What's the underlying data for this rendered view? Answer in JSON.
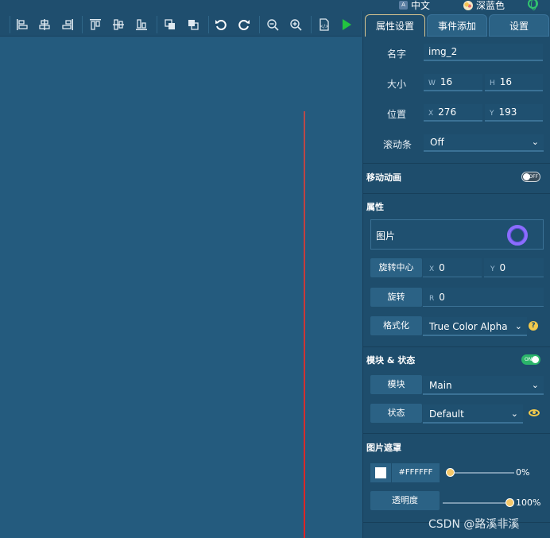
{
  "topbar": {
    "language": "中文",
    "theme": "深蓝色"
  },
  "toolbar": {
    "buttons": [
      "align-left-icon",
      "align-hcenter-icon",
      "align-right-icon",
      "align-top-icon",
      "align-vcenter-icon",
      "align-bottom-icon",
      "bring-forward-icon",
      "send-backward-icon",
      "undo-icon",
      "redo-icon",
      "zoom-out-icon",
      "zoom-in-icon",
      "export-code-icon",
      "run-icon"
    ]
  },
  "tabs": [
    {
      "label": "属性设置",
      "active": true
    },
    {
      "label": "事件添加",
      "active": false
    },
    {
      "label": "设置",
      "active": false
    }
  ],
  "props": {
    "name_label": "名字",
    "name_value": "img_2",
    "size_label": "大小",
    "w_prefix": "W",
    "w_value": "16",
    "h_prefix": "H",
    "h_value": "16",
    "pos_label": "位置",
    "x_prefix": "X",
    "x_value": "276",
    "y_prefix": "Y",
    "y_value": "193",
    "scroll_label": "滚动条",
    "scroll_value": "Off"
  },
  "anim": {
    "title": "移动动画",
    "toggle_text": "OFF"
  },
  "attrs": {
    "title": "属性",
    "image_label": "图片",
    "pivot_label": "旋转中心",
    "pivot_x_prefix": "X",
    "pivot_x": "0",
    "pivot_y_prefix": "Y",
    "pivot_y": "0",
    "rotate_label": "旋转",
    "rotate_prefix": "R",
    "rotate_value": "0",
    "format_label": "格式化",
    "format_value": "True Color Alpha",
    "help": "?"
  },
  "module": {
    "title": "模块 & 状态",
    "toggle_text": "ON",
    "module_label": "模块",
    "module_value": "Main",
    "state_label": "状态",
    "state_value": "Default"
  },
  "mask": {
    "title": "图片遮罩",
    "color_hex": "#FFFFFF",
    "color_value": 0,
    "color_value_text": "0%",
    "opacity_label": "透明度",
    "opacity_value": 100,
    "opacity_value_text": "100%"
  },
  "watermark": "CSDN @路溪非溪",
  "colors": {
    "accent_ring": "#8b6cff",
    "toggle_on": "#2bb56a",
    "arrow": "#e02323"
  }
}
